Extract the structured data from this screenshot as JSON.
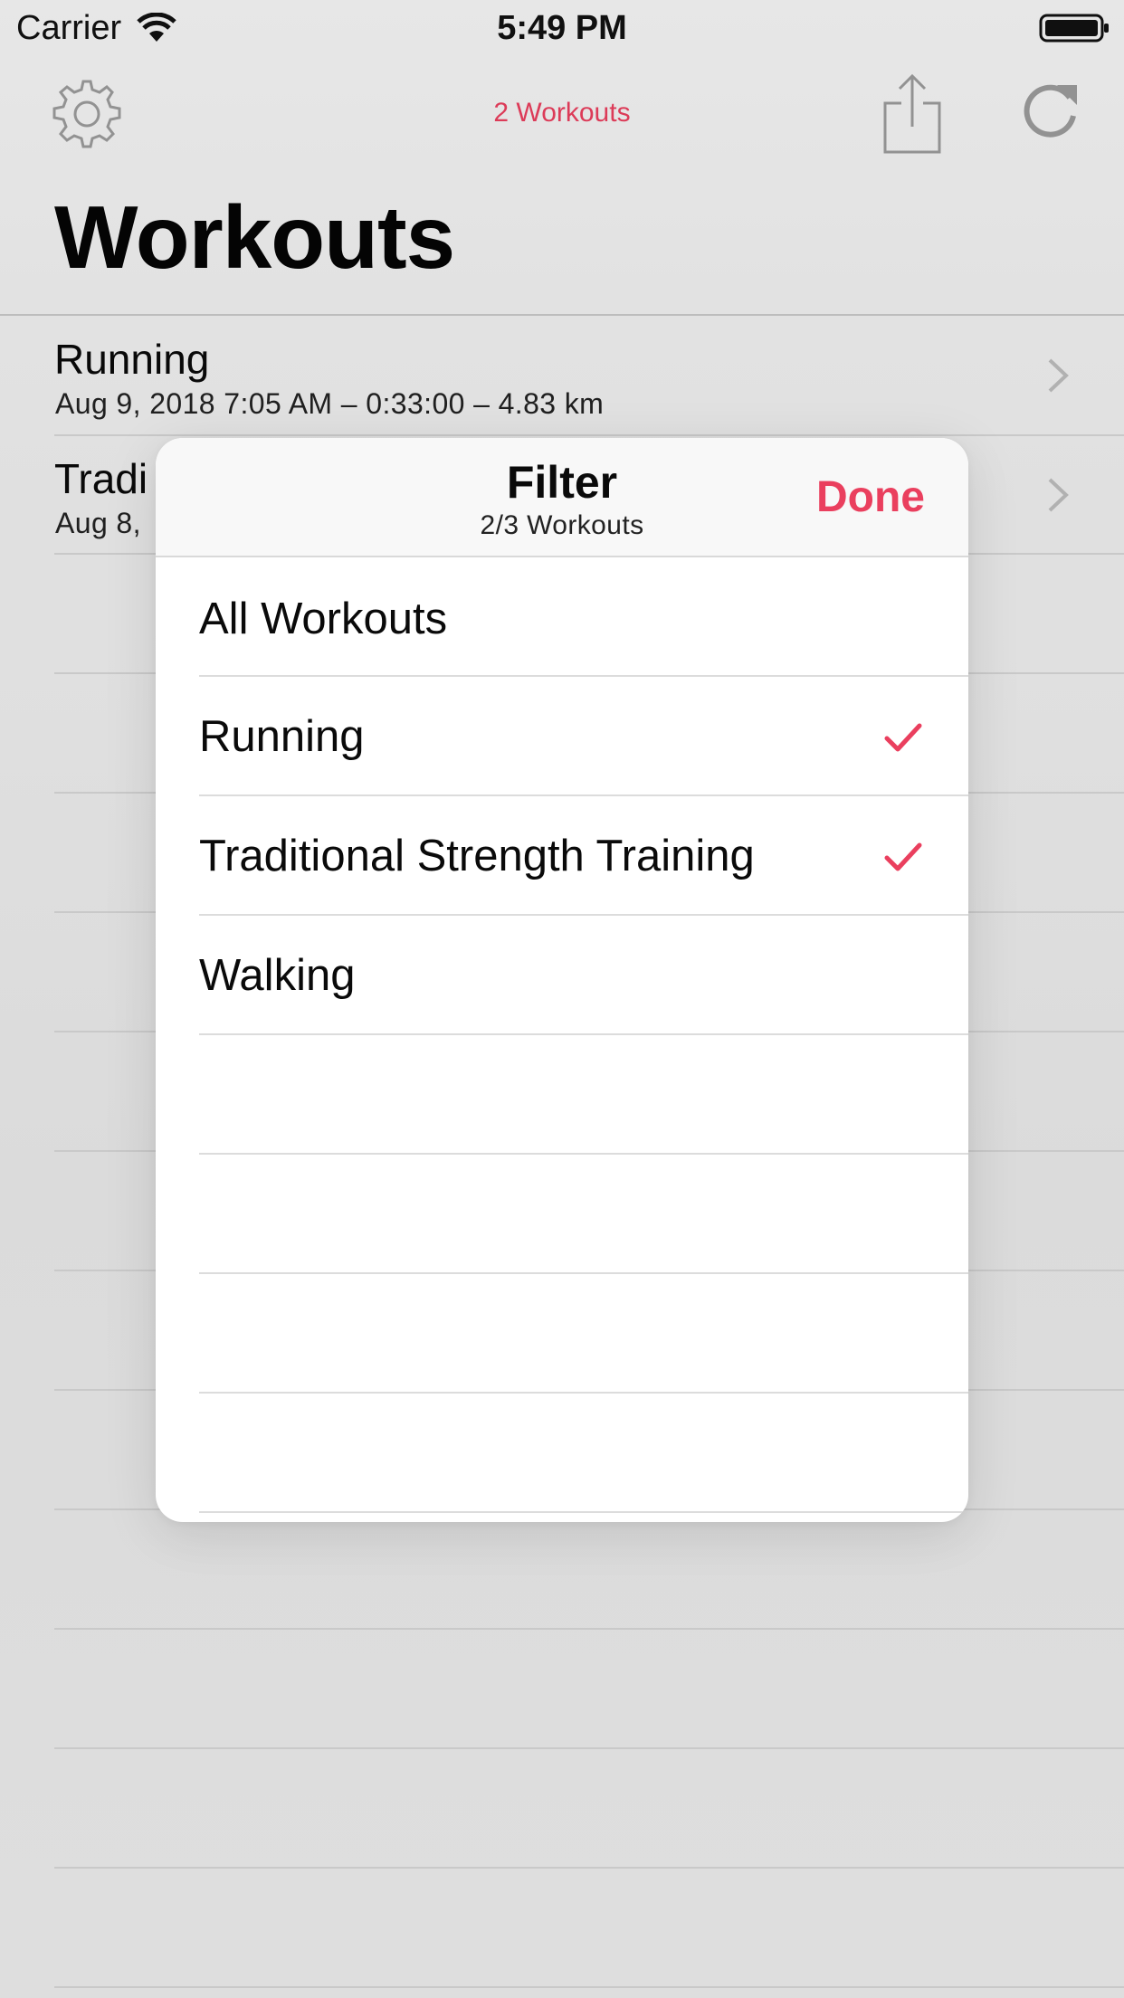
{
  "status_bar": {
    "carrier": "Carrier",
    "time": "5:49 PM"
  },
  "nav": {
    "count_label": "2 Workouts",
    "title": "Workouts",
    "icons": [
      "gear-icon",
      "share-icon",
      "refresh-icon"
    ]
  },
  "workouts": [
    {
      "title": "Running",
      "subtitle": "Aug 9, 2018 7:05 AM – 0:33:00 – 4.83 km"
    },
    {
      "title": "Tradi",
      "subtitle": "Aug 8,"
    }
  ],
  "filter": {
    "title": "Filter",
    "subtitle": "2/3 Workouts",
    "done_label": "Done",
    "options": [
      {
        "label": "All Workouts",
        "checked": false
      },
      {
        "label": "Running",
        "checked": true
      },
      {
        "label": "Traditional Strength Training",
        "checked": true
      },
      {
        "label": "Walking",
        "checked": false
      }
    ]
  },
  "colors": {
    "accent": "#ea3f5e",
    "text": "#0a0a0a",
    "separator": "#d6d6d6",
    "icon_gray": "#9c9c9c"
  }
}
